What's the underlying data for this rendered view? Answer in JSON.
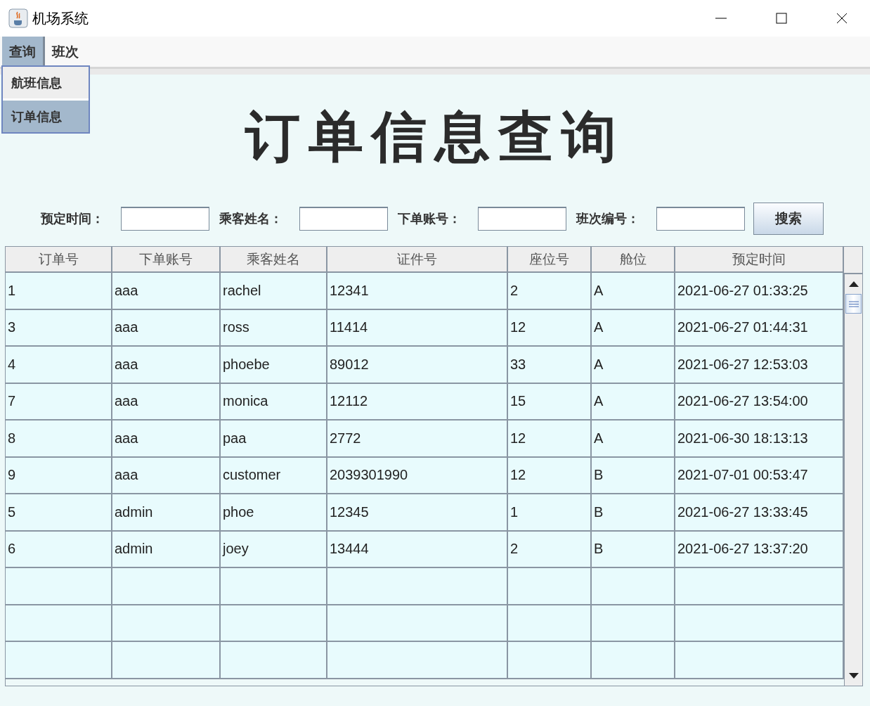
{
  "window": {
    "title": "机场系统"
  },
  "menu_bar": [
    {
      "label": "查询",
      "selected": true
    },
    {
      "label": "班次",
      "selected": false
    }
  ],
  "dropdown": [
    {
      "label": "航班信息",
      "selected": false
    },
    {
      "label": "订单信息",
      "selected": true
    }
  ],
  "page_title": "订单信息查询",
  "search_fields": [
    {
      "label": "预定时间："
    },
    {
      "label": "乘客姓名："
    },
    {
      "label": "下单账号："
    },
    {
      "label": "班次编号："
    }
  ],
  "search_button": "搜索",
  "table": {
    "columns": [
      "订单号",
      "下单账号",
      "乘客姓名",
      "证件号",
      "座位号",
      "舱位",
      "预定时间"
    ],
    "rows": [
      [
        "1",
        "aaa",
        "rachel",
        "12341",
        "2",
        "A",
        "2021-06-27 01:33:25"
      ],
      [
        "3",
        "aaa",
        "ross",
        "11414",
        "12",
        "A",
        "2021-06-27 01:44:31"
      ],
      [
        "4",
        "aaa",
        "phoebe",
        "89012",
        "33",
        "A",
        "2021-06-27 12:53:03"
      ],
      [
        "7",
        "aaa",
        "monica",
        "12112",
        "15",
        "A",
        "2021-06-27 13:54:00"
      ],
      [
        "8",
        "aaa",
        "paa",
        "2772",
        "12",
        "A",
        "2021-06-30 18:13:13"
      ],
      [
        "9",
        "aaa",
        "customer",
        "2039301990",
        "12",
        "B",
        "2021-07-01 00:53:47"
      ],
      [
        "5",
        "admin",
        "phoe",
        "12345",
        "1",
        "B",
        "2021-06-27 13:33:45"
      ],
      [
        "6",
        "admin",
        "joey",
        "13444",
        "2",
        "B",
        "2021-06-27 13:37:20"
      ]
    ]
  }
}
